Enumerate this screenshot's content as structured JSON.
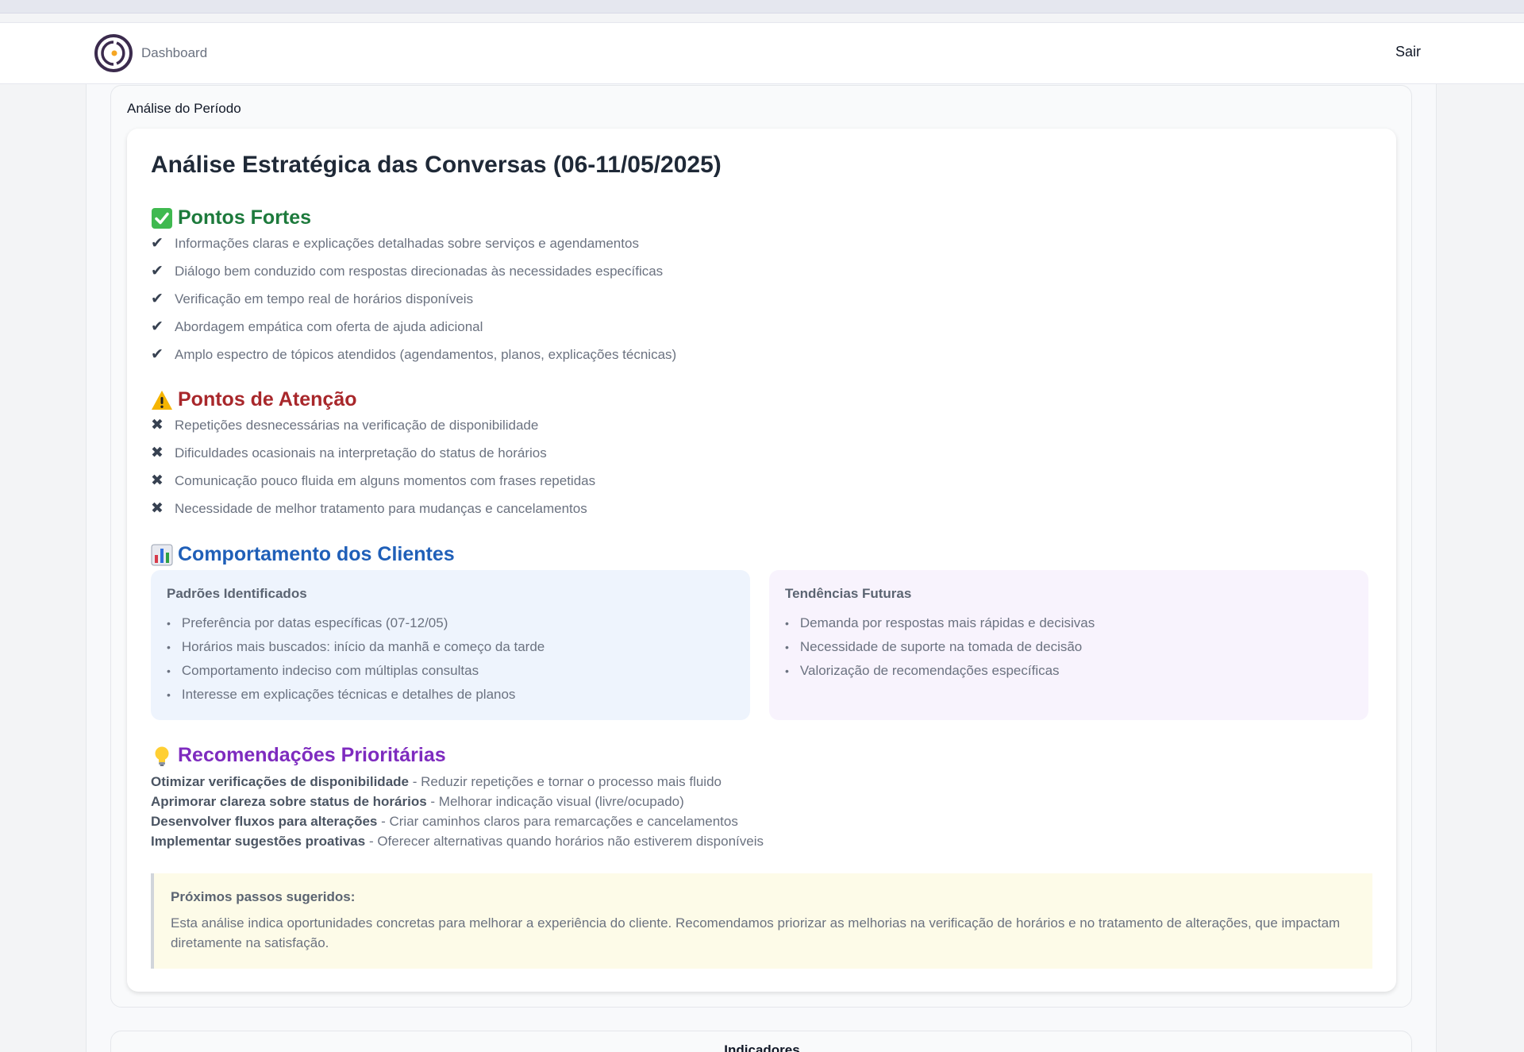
{
  "nav": {
    "link": "Dashboard",
    "logout": "Sair"
  },
  "section": {
    "title": "Análise do Período"
  },
  "report": {
    "title": "Análise Estratégica das Conversas (06-11/05/2025)",
    "strengths": {
      "title": "Pontos Fortes",
      "icon": "check-box-icon",
      "items": [
        "Informações claras e explicações detalhadas sobre serviços e agendamentos",
        "Diálogo bem conduzido com respostas direcionadas às necessidades específicas",
        "Verificação em tempo real de horários disponíveis",
        "Abordagem empática com oferta de ajuda adicional",
        "Amplo espectro de tópicos atendidos (agendamentos, planos, explicações técnicas)"
      ]
    },
    "attention": {
      "title": "Pontos de Atenção",
      "icon": "warning-icon",
      "items": [
        "Repetições desnecessárias na verificação de disponibilidade",
        "Dificuldades ocasionais na interpretação do status de horários",
        "Comunicação pouco fluida em alguns momentos com frases repetidas",
        "Necessidade de melhor tratamento para mudanças e cancelamentos"
      ]
    },
    "behavior": {
      "title": "Comportamento dos Clientes",
      "icon": "bar-chart-icon",
      "patterns": {
        "title": "Padrões Identificados",
        "items": [
          "Preferência por datas específicas (07-12/05)",
          "Horários mais buscados: início da manhã e começo da tarde",
          "Comportamento indeciso com múltiplas consultas",
          "Interesse em explicações técnicas e detalhes de planos"
        ]
      },
      "trends": {
        "title": "Tendências Futuras",
        "items": [
          "Demanda por respostas mais rápidas e decisivas",
          "Necessidade de suporte na tomada de decisão",
          "Valorização de recomendações específicas"
        ]
      }
    },
    "recommendations": {
      "title": "Recomendações Prioritárias",
      "icon": "lightbulb-icon",
      "items": [
        {
          "bold": "Otimizar verificações de disponibilidade",
          "text": " - Reduzir repetições e tornar o processo mais fluido"
        },
        {
          "bold": "Aprimorar clareza sobre status de horários",
          "text": " - Melhorar indicação visual (livre/ocupado)"
        },
        {
          "bold": "Desenvolver fluxos para alterações",
          "text": " - Criar caminhos claros para remarcações e cancelamentos"
        },
        {
          "bold": "Implementar sugestões proativas",
          "text": " - Oferecer alternativas quando horários não estiverem disponíveis"
        }
      ]
    },
    "next_steps": {
      "title": "Próximos passos sugeridos:",
      "text": "Esta análise indica oportunidades concretas para melhorar a experiência do cliente. Recomendamos priorizar as melhorias na verificação de horários e no tratamento de alterações, que impactam diretamente na satisfação."
    }
  },
  "next_section": {
    "title": "Indicadores"
  },
  "colors": {
    "green": "#1d7a3c",
    "red": "#a8272b",
    "blue": "#1f5fb8",
    "purple": "#7e2bbf",
    "logo": "#3b2b4d",
    "logo_dot": "#f5a623"
  }
}
